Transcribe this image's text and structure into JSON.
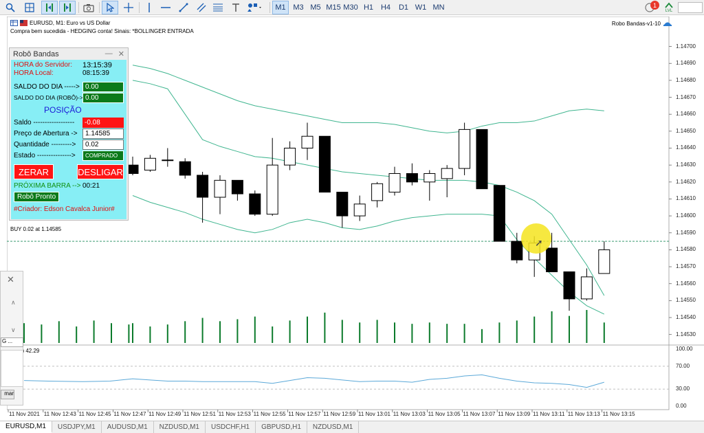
{
  "toolbar": {
    "timeframes": [
      "M1",
      "M3",
      "M5",
      "M15",
      "M30",
      "H1",
      "H4",
      "D1",
      "W1",
      "MN"
    ],
    "active_timeframe": "M1",
    "notifications": "1",
    "level_icon_label": "LVL"
  },
  "chart": {
    "symbol_text": "EURUSD, M1:  Euro vs US Dollar",
    "signal_text": "Compra bem sucedida - HEDGING conta! Sinais: *BOLLINGER ENTRADA",
    "ea_name": "Robo Bandas-v1-10",
    "buy_line_text": "BUY 0.02 at 1.14585",
    "oscillator_label": "4) 42.29",
    "price_levels": [
      "1.14700",
      "1.14690",
      "1.14680",
      "1.14670",
      "1.14660",
      "1.14650",
      "1.14640",
      "1.14630",
      "1.14620",
      "1.14610",
      "1.14600",
      "1.14590",
      "1.14580",
      "1.14570",
      "1.14560",
      "1.14550",
      "1.14540",
      "1.14530"
    ],
    "osc_levels": [
      "100.00",
      "70.00",
      "30.00",
      "0.00"
    ],
    "time_labels": [
      "11 Nov 2021",
      "11 Nov 12:43",
      "11 Nov 12:45",
      "11 Nov 12:47",
      "11 Nov 12:49",
      "11 Nov 12:51",
      "11 Nov 12:53",
      "11 Nov 12:55",
      "11 Nov 12:57",
      "11 Nov 12:59",
      "11 Nov 13:01",
      "11 Nov 13:03",
      "11 Nov 13:05",
      "11 Nov 13:07",
      "11 Nov 13:09",
      "11 Nov 13:11",
      "11 Nov 13:13",
      "11 Nov 13:15"
    ]
  },
  "chart_data": {
    "type": "candlestick",
    "bullish_color": "#ffffff",
    "bearish_color": "#000000",
    "band_color": "#3fb58f",
    "volume_color": "#0a7a2a",
    "oscillator_color": "#5aa8d8",
    "ylim": [
      1.14525,
      1.14712
    ],
    "candles": [
      {
        "o": 1.1463,
        "h": 1.14635,
        "l": 1.14624,
        "c": 1.14625
      },
      {
        "o": 1.14627,
        "h": 1.14636,
        "l": 1.14626,
        "c": 1.14634
      },
      {
        "o": 1.14633,
        "h": 1.1464,
        "l": 1.14629,
        "c": 1.14633
      },
      {
        "o": 1.14632,
        "h": 1.14634,
        "l": 1.14622,
        "c": 1.14624
      },
      {
        "o": 1.14624,
        "h": 1.14626,
        "l": 1.14596,
        "c": 1.14611
      },
      {
        "o": 1.14611,
        "h": 1.14624,
        "l": 1.14601,
        "c": 1.14621
      },
      {
        "o": 1.14621,
        "h": 1.14621,
        "l": 1.14609,
        "c": 1.14613
      },
      {
        "o": 1.14613,
        "h": 1.14615,
        "l": 1.146,
        "c": 1.14601
      },
      {
        "o": 1.14601,
        "h": 1.14646,
        "l": 1.146,
        "c": 1.1463
      },
      {
        "o": 1.1463,
        "h": 1.14644,
        "l": 1.14627,
        "c": 1.1464
      },
      {
        "o": 1.1464,
        "h": 1.14655,
        "l": 1.14633,
        "c": 1.14647
      },
      {
        "o": 1.14647,
        "h": 1.14647,
        "l": 1.14614,
        "c": 1.14614
      },
      {
        "o": 1.14614,
        "h": 1.14614,
        "l": 1.14593,
        "c": 1.146
      },
      {
        "o": 1.146,
        "h": 1.14612,
        "l": 1.14597,
        "c": 1.14607
      },
      {
        "o": 1.14609,
        "h": 1.1462,
        "l": 1.14605,
        "c": 1.14619
      },
      {
        "o": 1.14614,
        "h": 1.14629,
        "l": 1.14612,
        "c": 1.14625
      },
      {
        "o": 1.14625,
        "h": 1.14631,
        "l": 1.14618,
        "c": 1.1462
      },
      {
        "o": 1.1462,
        "h": 1.14627,
        "l": 1.14609,
        "c": 1.14625
      },
      {
        "o": 1.14622,
        "h": 1.1463,
        "l": 1.14611,
        "c": 1.14628
      },
      {
        "o": 1.14628,
        "h": 1.14655,
        "l": 1.14624,
        "c": 1.14651
      },
      {
        "o": 1.14651,
        "h": 1.14651,
        "l": 1.14616,
        "c": 1.14616
      },
      {
        "o": 1.14618,
        "h": 1.14618,
        "l": 1.14585,
        "c": 1.14585
      },
      {
        "o": 1.14585,
        "h": 1.1459,
        "l": 1.14572,
        "c": 1.14574
      },
      {
        "o": 1.14574,
        "h": 1.14588,
        "l": 1.14564,
        "c": 1.14584
      },
      {
        "o": 1.14581,
        "h": 1.1459,
        "l": 1.14567,
        "c": 1.14567
      },
      {
        "o": 1.14567,
        "h": 1.14567,
        "l": 1.14544,
        "c": 1.14551
      },
      {
        "o": 1.14551,
        "h": 1.14569,
        "l": 1.1455,
        "c": 1.14564
      },
      {
        "o": 1.14566,
        "h": 1.14585,
        "l": 1.14566,
        "c": 1.1458
      }
    ],
    "band_upper": [
      1.14689,
      1.14687,
      1.14684,
      1.1468,
      1.14676,
      1.14672,
      1.14668,
      1.14665,
      1.14663,
      1.14661,
      1.14659,
      1.14657,
      1.14655,
      1.14655,
      1.14655,
      1.14654,
      1.14652,
      1.1465,
      1.14649,
      1.1465,
      1.14653,
      1.14655,
      1.14655,
      1.14656,
      1.14659,
      1.14662,
      1.14663,
      1.14662
    ],
    "band_middle": [
      1.1468,
      1.14678,
      1.14675,
      1.1466,
      1.14645,
      1.14641,
      1.14638,
      1.14635,
      1.14634,
      1.14632,
      1.1463,
      1.14628,
      1.14626,
      1.14625,
      1.14624,
      1.14623,
      1.14622,
      1.14621,
      1.14621,
      1.14621,
      1.1462,
      1.14618,
      1.14614,
      1.14609,
      1.14601,
      1.14586,
      1.14571,
      1.14553
    ],
    "band_lower": [
      1.14612,
      1.14608,
      1.14605,
      1.14602,
      1.14598,
      1.14595,
      1.14592,
      1.1459,
      1.14592,
      1.14596,
      1.14598,
      1.14596,
      1.14593,
      1.14592,
      1.14594,
      1.14597,
      1.14599,
      1.146,
      1.14601,
      1.14601,
      1.14601,
      1.146,
      1.14586,
      1.14575,
      1.14565,
      1.14555,
      1.14547,
      1.14542
    ],
    "volume": [
      30,
      25,
      28,
      33,
      38,
      33,
      36,
      40,
      25,
      34,
      40,
      46,
      35,
      31,
      35,
      31,
      29,
      31,
      29,
      29,
      21,
      31,
      34,
      40,
      48,
      41,
      50,
      31
    ],
    "volume_max": 50,
    "oscillator": [
      48,
      46,
      44,
      44,
      43,
      43,
      43,
      43,
      40,
      45,
      50,
      49,
      46,
      43,
      44,
      44,
      42,
      47,
      49,
      53,
      55,
      49,
      44,
      41,
      40,
      38,
      33,
      42
    ],
    "osc_ylim": [
      0,
      100
    ]
  },
  "panel": {
    "title": "Robô Bandas",
    "server_time_label": "HORA do Servidor:",
    "server_time": "13:15:39",
    "local_time_label": "HORA Local:",
    "local_time": "08:15:39",
    "saldo_dia_label": "SALDO DO DIA ----->",
    "saldo_dia": "0.00",
    "saldo_robo_label": "SALDO DO DIA (ROBÔ)->",
    "saldo_robo": "0.00",
    "posicao_heading": "POSIÇÃO",
    "saldo_label": "Saldo ------------------",
    "saldo": "-0.08",
    "preco_label": "Preço de Abertura ->",
    "preco": "1.14585",
    "quantidade_label": "Quantidade --------->",
    "quantidade": "0.02",
    "estado_label": "Estado --------------->",
    "estado": "COMPRADO",
    "zerar": "ZERAR",
    "desligar": "DESLIGAR",
    "proxima_label": "PRÓXIMA BARRA -->",
    "proxima_value": "00:21",
    "robot_status": "Robô Pronto",
    "creator": "#Criador: Edson Cavalca Junior#"
  },
  "left_dialog": {
    "field_text": "G ...",
    "button_text": "mar"
  },
  "tabs": [
    "EURUSD,M1",
    "USDJPY,M1",
    "AUDUSD,M1",
    "NZDUSD,M1",
    "USDCHF,H1",
    "GBPUSD,H1",
    "NZDUSD,M1"
  ],
  "active_tab": "EURUSD,M1"
}
